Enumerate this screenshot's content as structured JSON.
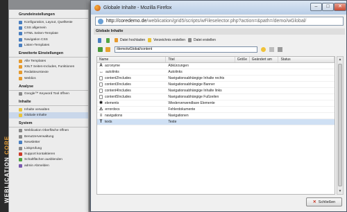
{
  "brand": {
    "text": "WEBLICATION",
    "core": "CORE"
  },
  "sidebar": {
    "sections": [
      {
        "title": "Grundeinstellungen",
        "items": [
          {
            "label": "Konfiguration, Layout, Quellteste",
            "icon": "blue"
          },
          {
            "label": "CSS allgemein",
            "icon": "blue"
          },
          {
            "label": "HTML Seiten-Template",
            "icon": "blue"
          },
          {
            "label": "Navigation CSS",
            "icon": "blue"
          },
          {
            "label": "Listen-Templates",
            "icon": "blue"
          }
        ]
      },
      {
        "title": "Erweiterte Einstellungen",
        "items": [
          {
            "label": "Alle Templates",
            "icon": "orange"
          },
          {
            "label": "XSLT Seiten-Includes, Funktionen",
            "icon": "orange"
          },
          {
            "label": "Redakteurstexte",
            "icon": "orange"
          },
          {
            "label": "Weblics",
            "icon": "orange"
          }
        ]
      },
      {
        "title": "Analyse",
        "items": [
          {
            "label": "Google™ Keyword Tool öffnen",
            "icon": "gray"
          }
        ]
      },
      {
        "title": "Inhalte",
        "items": [
          {
            "label": "Inhalte verwalten",
            "icon": "yellow"
          },
          {
            "label": "Globale Inhalte",
            "icon": "yellow",
            "active": true
          }
        ]
      },
      {
        "title": "System",
        "items": [
          {
            "label": "Weblication Oberfläche öffnen",
            "icon": "gray"
          },
          {
            "label": "Benutzerverwaltung",
            "icon": "gray"
          },
          {
            "label": "Newsletter",
            "icon": "blue"
          },
          {
            "label": "Linkprüfung",
            "icon": "gray"
          },
          {
            "label": "Support kontaktieren",
            "icon": "red"
          },
          {
            "label": "Schaltflächen ausblenden",
            "icon": "green"
          },
          {
            "label": "admin Abmelden",
            "icon": "purple"
          }
        ]
      }
    ]
  },
  "window": {
    "title": "Globale Inhalte - Mozilla Firefox",
    "min_label": "–",
    "max_label": "□",
    "close_label": "✕",
    "url_host": "http://coredemo.de",
    "url_path": "/weblication/grid5/scripts/wFileselector.php?action=&path=/demo/wGlobal/",
    "panel_title": "Globale Inhalte",
    "toolbar": {
      "upload": "Datei hochladen",
      "new_folder": "Verzeichnis erstellen",
      "new_file": "Datei erstellen"
    },
    "path_value": "/demo/wGlobal/content",
    "columns": [
      "Name",
      "Titel",
      "Größe",
      "Geändert am",
      "Status"
    ],
    "rows": [
      {
        "name": "acronyme",
        "title": "Abkürzungen",
        "icon": "abbr"
      },
      {
        "name": "autolinks",
        "title": "Autolinks",
        "icon": "link"
      },
      {
        "name": "content2Includes",
        "title": "Navigationsabhängige Inhalte rechts",
        "icon": "doc"
      },
      {
        "name": "content3Includes",
        "title": "Navigationsabhängige Banner",
        "icon": "doc"
      },
      {
        "name": "content4Includes",
        "title": "Navigationsabhängige Inhalte links",
        "icon": "doc"
      },
      {
        "name": "content5Includes",
        "title": "Navigationsabhängige Fußzeilen",
        "icon": "doc"
      },
      {
        "name": "elements",
        "title": "Wiederverwendbare Elemente",
        "icon": "puzzle"
      },
      {
        "name": "errordocs",
        "title": "Fehlerdokumente",
        "icon": "warn"
      },
      {
        "name": "navigations",
        "title": "Navigationen",
        "icon": "nav"
      },
      {
        "name": "texts",
        "title": "Texte",
        "icon": "text",
        "selected": true
      }
    ],
    "close_button": "Schließen"
  }
}
